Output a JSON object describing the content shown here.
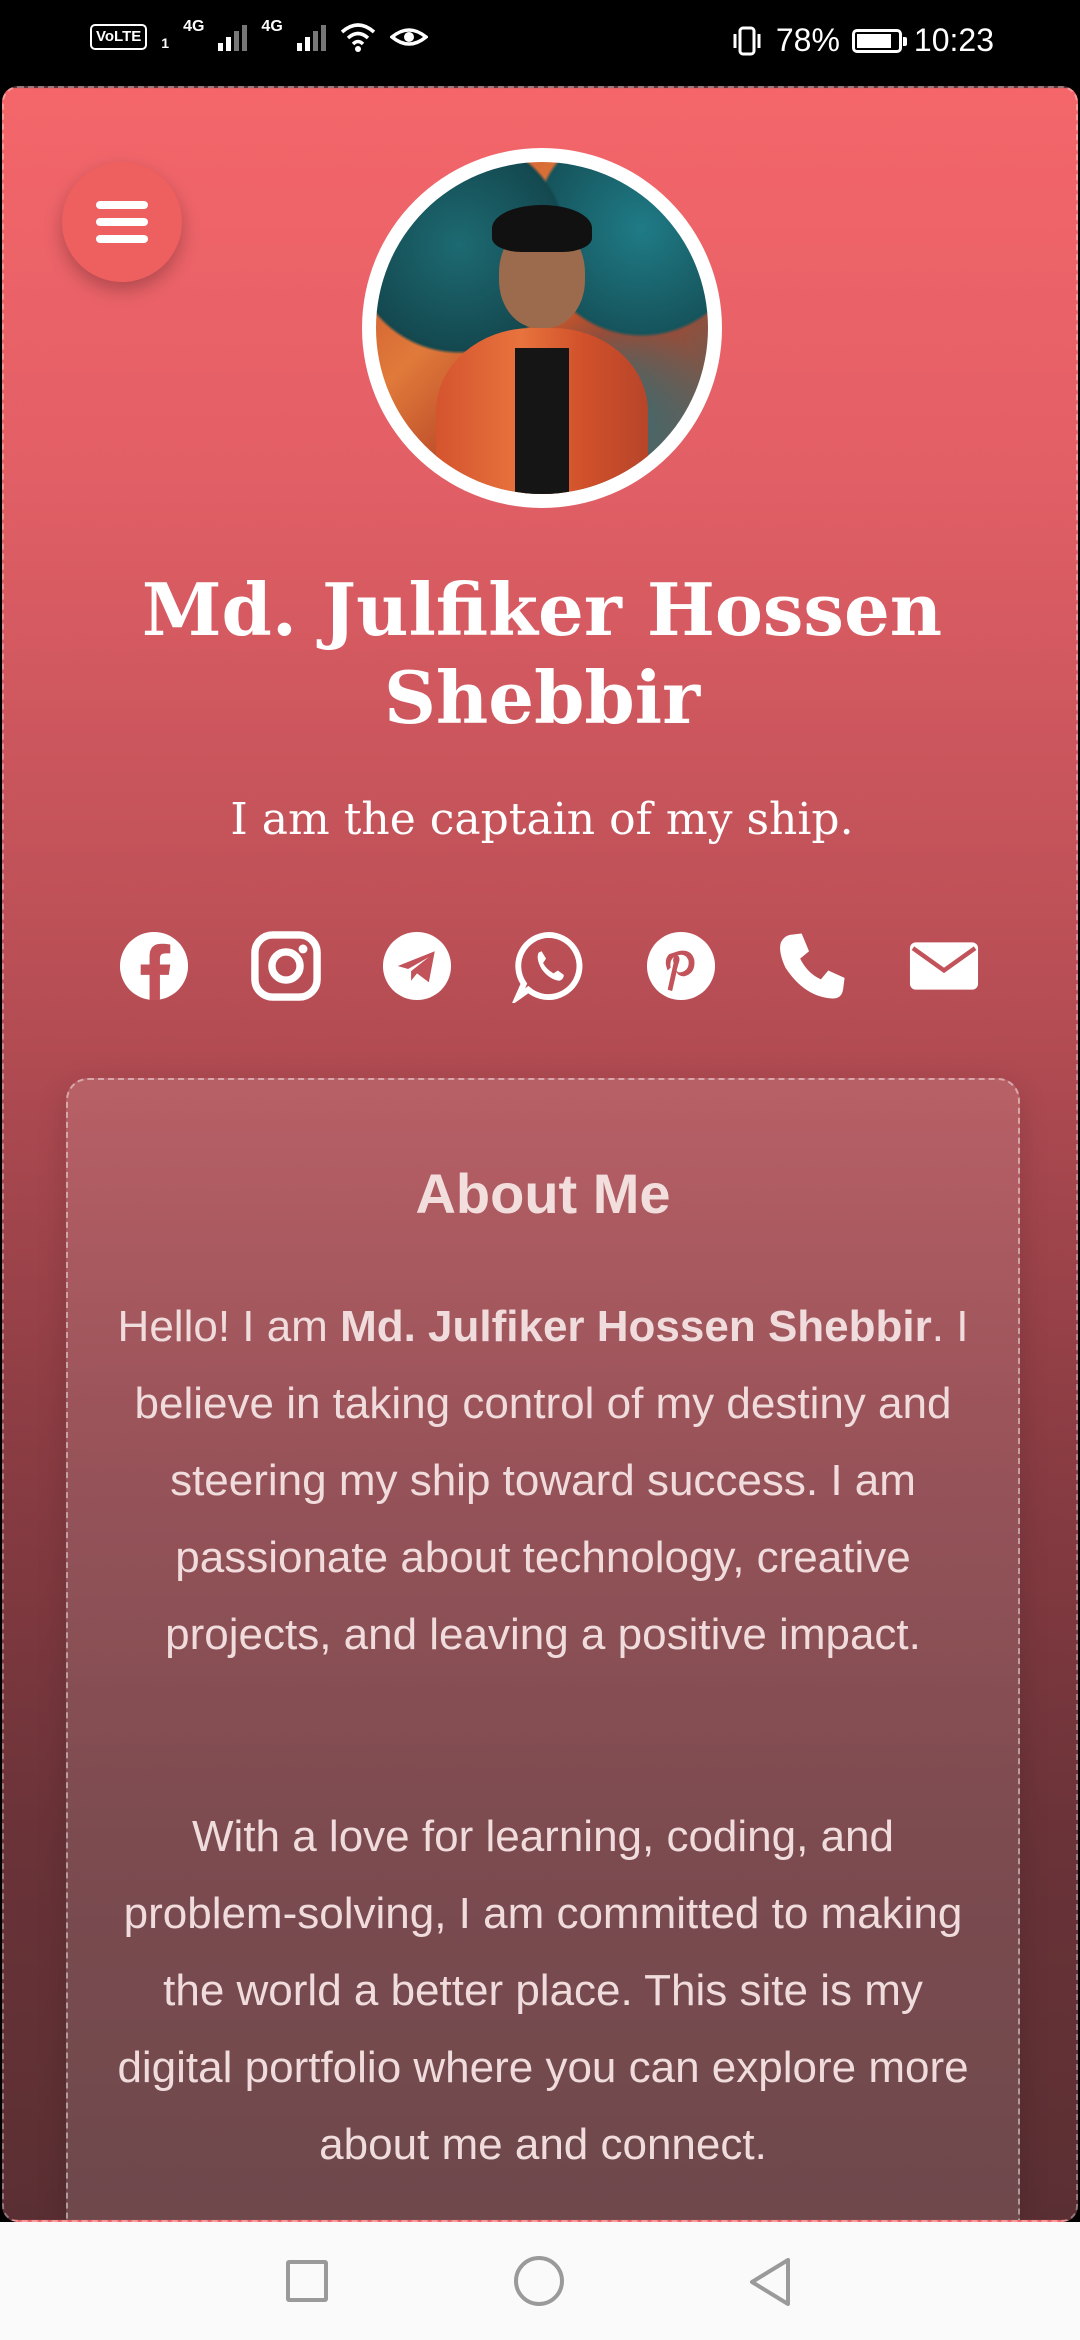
{
  "status_bar": {
    "volte": "VoLTE",
    "sim_slot": "1",
    "signal1": "4G",
    "signal2": "4G",
    "battery": "78%",
    "time": "10:23"
  },
  "profile": {
    "name": "Md. Julfiker Hossen Shebbir",
    "tagline": "I am the captain of my ship."
  },
  "socials": [
    {
      "name": "facebook-icon"
    },
    {
      "name": "instagram-icon"
    },
    {
      "name": "telegram-icon"
    },
    {
      "name": "whatsapp-icon"
    },
    {
      "name": "pinterest-icon"
    },
    {
      "name": "phone-icon"
    },
    {
      "name": "email-icon"
    }
  ],
  "about": {
    "title": "About Me",
    "p1_pre": "Hello! I am ",
    "p1_name": "Md. Julfiker Hossen Shebbir",
    "p1_post": ". I believe in taking control of my destiny and steering my ship toward success. I am passionate about technology, creative projects, and leaving a positive impact.",
    "p2": "With a love for learning, coding, and problem-solving, I am committed to making the world a better place. This site is my digital portfolio where you can explore more about me and connect."
  },
  "colors": {
    "gradient_top": "#f4666a",
    "gradient_bottom": "#5a2f33",
    "menu_button": "#ee5f5f"
  }
}
